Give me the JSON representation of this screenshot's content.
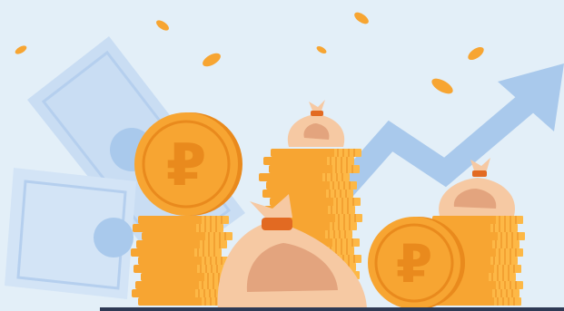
{
  "illustration": {
    "currency_symbol": "₽",
    "colors": {
      "background": "#e3eff8",
      "coin_gold": "#f7a532",
      "coin_dark": "#e98a1d",
      "coin_light": "#ffc04f",
      "banknote": "#c9ddf3",
      "arrow": "#a9c9ec",
      "money_bag": "#f6c9a3",
      "bag_tie": "#e26a22",
      "bottom_bar": "#2e3a55"
    }
  }
}
